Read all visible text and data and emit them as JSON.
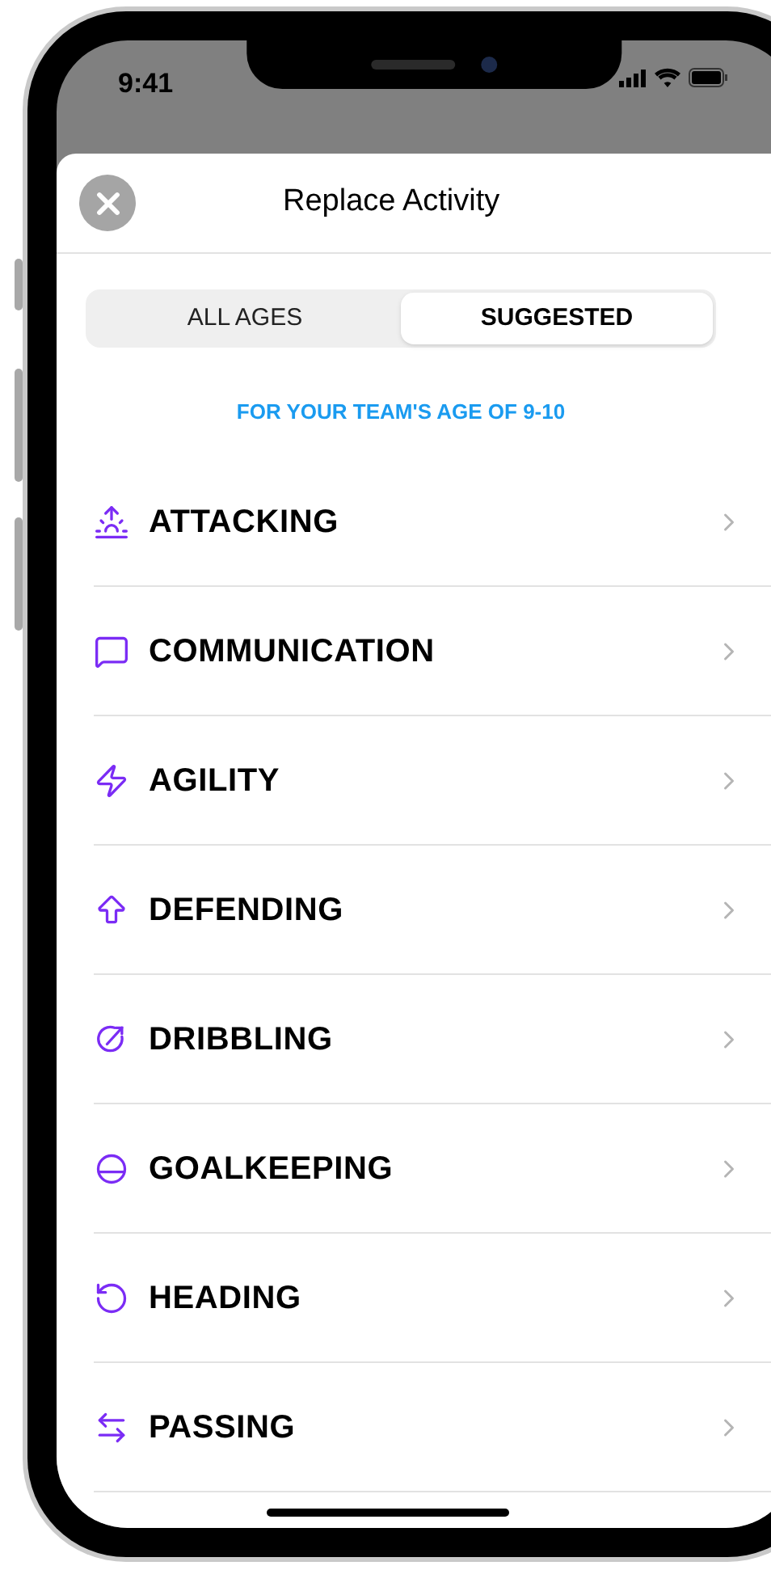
{
  "status_bar": {
    "time": "9:41"
  },
  "header": {
    "title": "Replace Activity"
  },
  "segments": [
    {
      "label": "ALL AGES",
      "selected": false
    },
    {
      "label": "SUGGESTED",
      "selected": true
    }
  ],
  "subtitle": "FOR YOUR TEAM'S AGE OF 9-10",
  "activities": [
    {
      "label": "ATTACKING",
      "kind": "attacking"
    },
    {
      "label": "COMMUNICATION",
      "kind": "communication"
    },
    {
      "label": "AGILITY",
      "kind": "agility"
    },
    {
      "label": "DEFENDING",
      "kind": "defending"
    },
    {
      "label": "DRIBBLING",
      "kind": "dribbling"
    },
    {
      "label": "GOALKEEPING",
      "kind": "goalkeeping"
    },
    {
      "label": "HEADING",
      "kind": "heading"
    },
    {
      "label": "PASSING",
      "kind": "passing"
    }
  ]
}
